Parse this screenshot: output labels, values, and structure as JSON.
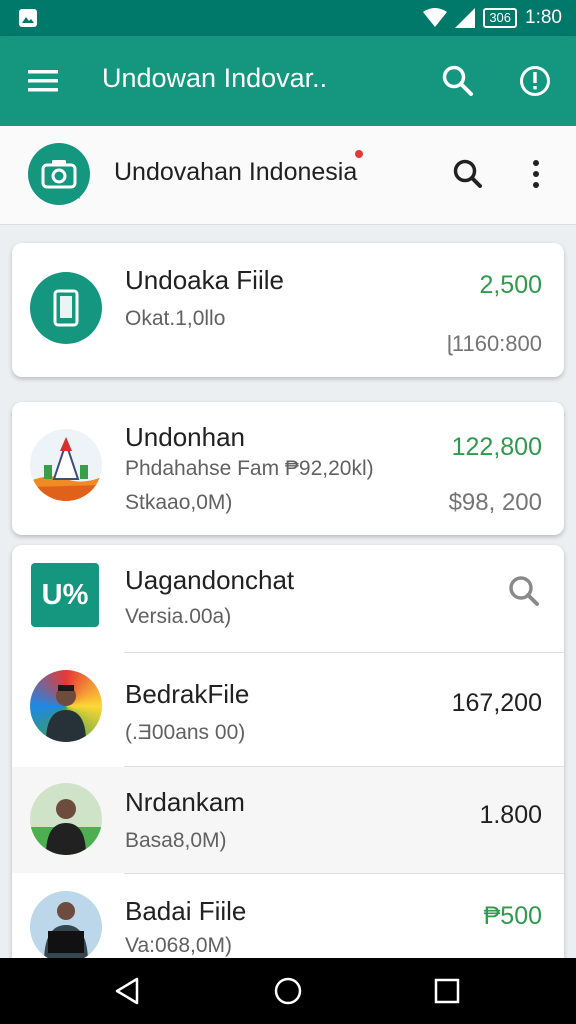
{
  "status_bar": {
    "notification_icon": "image-notification-icon",
    "battery_label": "306",
    "time": "1:80"
  },
  "app_bar": {
    "title": "Undowan Indovar..",
    "menu_icon": "hamburger-menu-icon",
    "search_icon": "search-icon",
    "info_icon": "alert-info-icon"
  },
  "sub_header": {
    "logo_icon": "camera-chat-icon",
    "title": "Undovahan Indonesia",
    "search_icon": "search-icon",
    "more_icon": "more-vert-icon"
  },
  "cards": [
    {
      "title": "Undoaka Fiile",
      "subtitle": "Okat.1,0llo",
      "amount": "2,500",
      "secondary": "ɭ1160:800",
      "icon": "phone-icon"
    },
    {
      "title": "Undonhan",
      "subtitle": "Phdahahse Fam ₱92,20kl)",
      "line3": "Stkaao,0M)",
      "amount": "122,800",
      "secondary": "$98, 200",
      "icon": "temple-avatar"
    }
  ],
  "list": {
    "header": {
      "title": "Uagandonchat",
      "subtitle": "Versia.00a)",
      "icon_text": "U%",
      "search_icon": "search-icon"
    },
    "items": [
      {
        "title": "BedrakFile",
        "subtitle": "(.Ǝ00ans 00)",
        "amount": "167,200"
      },
      {
        "title": "Nrdankam",
        "subtitle": "Basa8,0M)",
        "amount": "1.800"
      },
      {
        "title": "Badai Fiile",
        "subtitle": "Va:068,0M)",
        "amount": "₱500"
      }
    ]
  },
  "nav_bar": {
    "back": "back-triangle-icon",
    "home": "home-circle-icon",
    "recents": "recents-square-icon"
  },
  "colors": {
    "primary": "#14967f",
    "primary_dark": "#00796b",
    "green_amount": "#2e9a4a"
  }
}
